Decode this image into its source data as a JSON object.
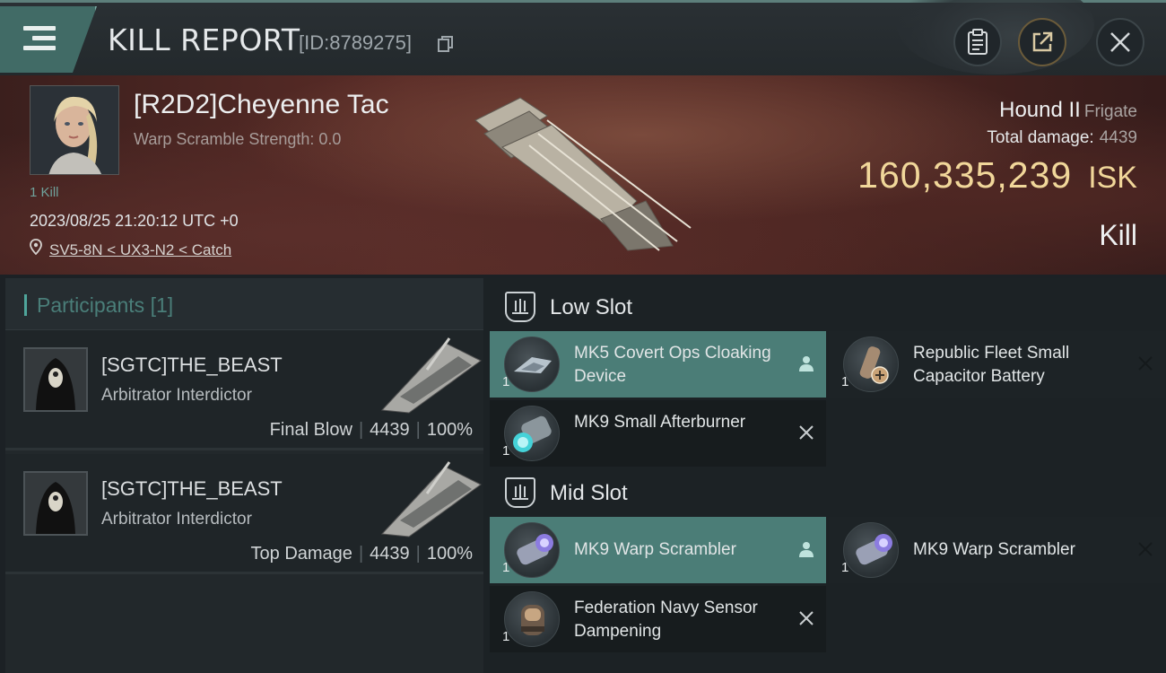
{
  "header": {
    "title": "KILL REPORT",
    "report_id": "[ID:8789275]",
    "icons": {
      "menu": "hamburger-menu-icon",
      "copy": "copy-icon",
      "clipboard": "clipboard-icon",
      "share": "share-icon",
      "close": "close-icon"
    }
  },
  "victim": {
    "name": "[R2D2]Cheyenne Tac",
    "warp_strength": "Warp Scramble Strength: 0.0",
    "kill_count": "1 Kill",
    "timestamp": "2023/08/25 21:20:12 UTC +0",
    "location": "SV5-8N < UX3-N2 < Catch",
    "ship_name": "Hound II",
    "ship_class": "Frigate",
    "total_damage_label": "Total damage:",
    "total_damage_value": "4439",
    "isk_value": "160,335,239",
    "isk_unit": "ISK",
    "result": "Kill"
  },
  "participants": {
    "heading": "Participants",
    "count": "[1]",
    "rows": [
      {
        "name": "[SGTC]THE_BEAST",
        "ship": "Arbitrator Interdictor",
        "role": "Final Blow",
        "damage": "4439",
        "percent": "100%"
      },
      {
        "name": "[SGTC]THE_BEAST",
        "ship": "Arbitrator Interdictor",
        "role": "Top Damage",
        "damage": "4439",
        "percent": "100%"
      }
    ],
    "separator": "|"
  },
  "fitting": {
    "low_slot": {
      "title": "Low Slot",
      "modules": [
        {
          "name": "MK5 Covert Ops Cloaking Device",
          "qty": "1",
          "status": "person-icon",
          "state": "dropped"
        },
        {
          "name": "Republic Fleet Small Capacitor Battery",
          "qty": "1",
          "status": "close-icon",
          "state": "destroyed"
        },
        {
          "name": "MK9 Small Afterburner",
          "qty": "1",
          "status": "close-icon",
          "state": "destroyed"
        }
      ]
    },
    "mid_slot": {
      "title": "Mid Slot",
      "modules": [
        {
          "name": "MK9 Warp Scrambler",
          "qty": "1",
          "status": "person-icon",
          "state": "dropped"
        },
        {
          "name": "MK9 Warp Scrambler",
          "qty": "1",
          "status": "close-icon",
          "state": "destroyed"
        },
        {
          "name": "Federation Navy Sensor Dampening",
          "qty": "1",
          "status": "close-icon",
          "state": "destroyed"
        }
      ]
    }
  },
  "colors": {
    "accent_teal": "#4b7d77",
    "isk_gold": "#f1d79a",
    "banner_red": "#5a2c27"
  }
}
